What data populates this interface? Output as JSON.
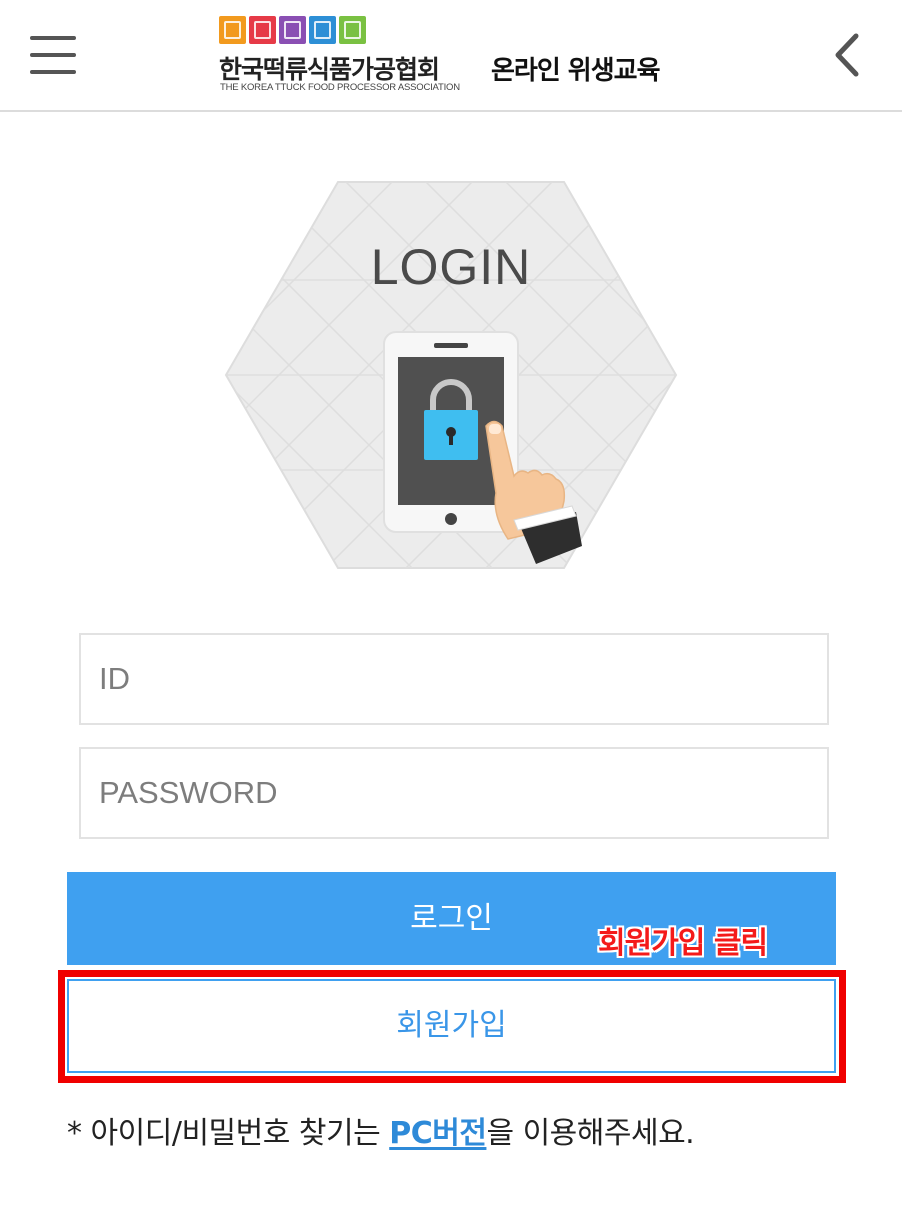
{
  "header": {
    "menu_icon": "hamburger-menu-icon",
    "back_icon": "chevron-left-icon",
    "logo_korean": "한국떡류식품가공협회",
    "logo_english": "THE KOREA TTUCK FOOD PROCESSOR ASSOCIATION",
    "site_title": "온라인 위생교육",
    "logo_tile_colors": [
      "#f29a1e",
      "#e63a47",
      "#8a4fb3",
      "#2d8fd6",
      "#7ac142"
    ]
  },
  "hero": {
    "title": "LOGIN",
    "illustration": "phone-lock-hand-illustration"
  },
  "form": {
    "id_placeholder": "ID",
    "password_placeholder": "PASSWORD",
    "login_label": "로그인",
    "signup_label": "회원가입"
  },
  "annotation": {
    "label": "회원가입 클릭",
    "color": "#f00000"
  },
  "notice": {
    "prefix": "* 아이디/비밀번호 찾기는 ",
    "link": "PC버전",
    "suffix": "을 이용해주세요."
  },
  "colors": {
    "accent": "#3fa0f0",
    "link": "#2e8ad8",
    "lock": "#3fbef0"
  }
}
